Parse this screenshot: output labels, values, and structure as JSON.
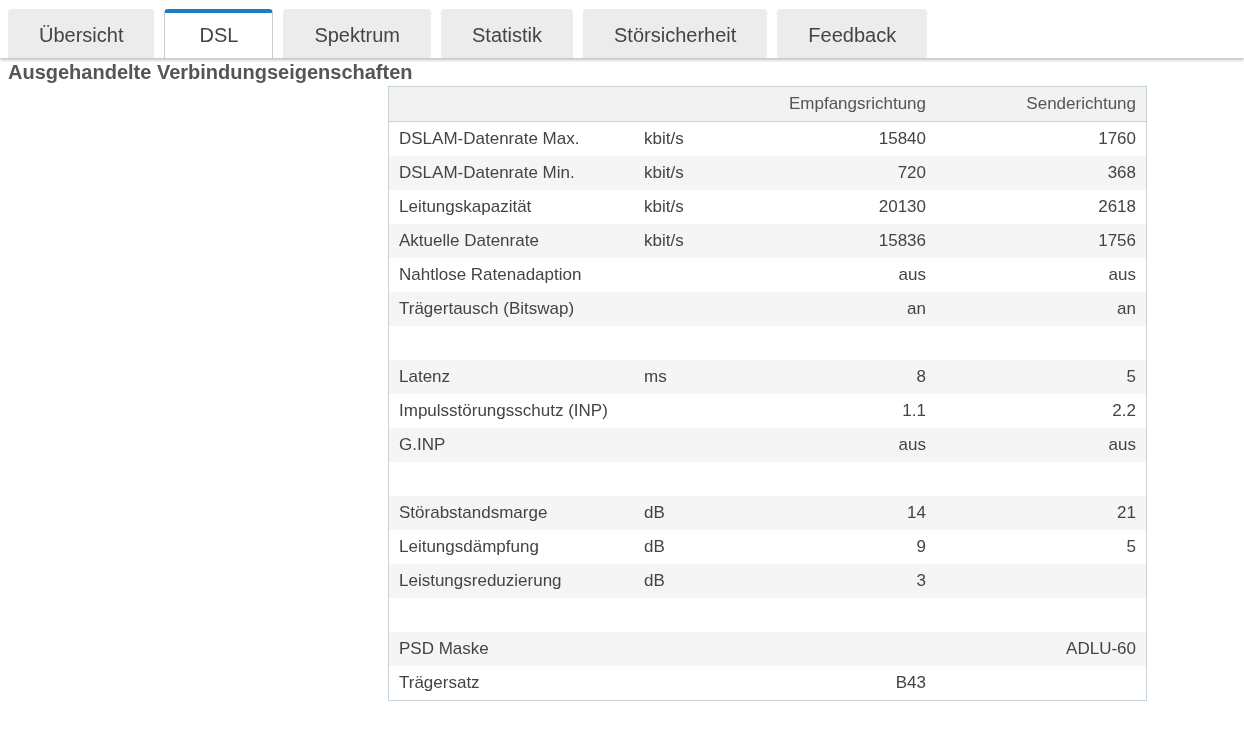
{
  "tabs": [
    {
      "label": "Übersicht",
      "selected": false
    },
    {
      "label": "DSL",
      "selected": true
    },
    {
      "label": "Spektrum",
      "selected": false
    },
    {
      "label": "Statistik",
      "selected": false
    },
    {
      "label": "Störsicherheit",
      "selected": false
    },
    {
      "label": "Feedback",
      "selected": false
    }
  ],
  "heading": "Ausgehandelte Verbindungseigenschaften",
  "table": {
    "columns": [
      "Empfangsrichtung",
      "Senderichtung"
    ],
    "rows": [
      {
        "kind": "data",
        "label": "DSLAM-Datenrate Max.",
        "unit": "kbit/s",
        "down": "15840",
        "up": "1760"
      },
      {
        "kind": "data",
        "label": "DSLAM-Datenrate Min.",
        "unit": "kbit/s",
        "down": "720",
        "up": "368"
      },
      {
        "kind": "data",
        "label": "Leitungskapazität",
        "unit": "kbit/s",
        "down": "20130",
        "up": "2618"
      },
      {
        "kind": "data",
        "label": "Aktuelle Datenrate",
        "unit": "kbit/s",
        "down": "15836",
        "up": "1756"
      },
      {
        "kind": "data",
        "label": "Nahtlose Ratenadaption",
        "down": "aus",
        "up": "aus"
      },
      {
        "kind": "data",
        "label": "Trägertausch (Bitswap)",
        "down": "an",
        "up": "an"
      },
      {
        "kind": "spacer"
      },
      {
        "kind": "data",
        "label": "Latenz",
        "unit": "ms",
        "down": "8",
        "up": "5"
      },
      {
        "kind": "data",
        "label": "Impulsstörungsschutz (INP)",
        "down": "1.1",
        "up": "2.2"
      },
      {
        "kind": "data",
        "label": "G.INP",
        "down": "aus",
        "up": "aus"
      },
      {
        "kind": "spacer"
      },
      {
        "kind": "data",
        "label": "Störabstandsmarge",
        "unit": "dB",
        "down": "14",
        "up": "21"
      },
      {
        "kind": "data",
        "label": "Leitungsdämpfung",
        "unit": "dB",
        "down": "9",
        "up": "5"
      },
      {
        "kind": "data",
        "label": "Leistungsreduzierung",
        "unit": "dB",
        "down": "3"
      },
      {
        "kind": "spacer"
      },
      {
        "kind": "data",
        "label": "PSD Maske",
        "up": "ADLU-60"
      },
      {
        "kind": "data",
        "label": "Trägersatz",
        "down": "B43"
      }
    ]
  }
}
